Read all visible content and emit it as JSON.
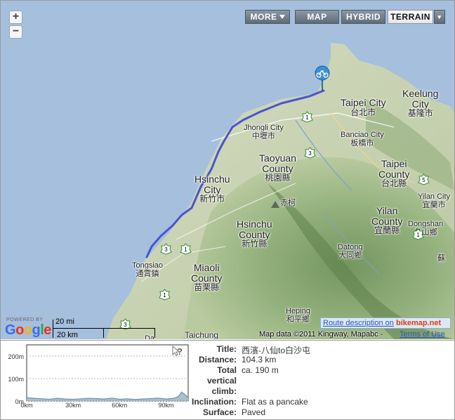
{
  "map_controls": {
    "zoom_in": "+",
    "zoom_out": "−",
    "types": [
      {
        "label": "MORE",
        "has_menu": true
      },
      {
        "label": "MAP"
      },
      {
        "label": "HYBRID"
      },
      {
        "label": "TERRAIN",
        "active": true
      }
    ],
    "dropdown_caret": "▾"
  },
  "places": {
    "taipei_city_en": "Taipei City",
    "taipei_city_zh": "台北市",
    "keelung_en": "Keelung\nCity",
    "keelung_zh": "基隆市",
    "jhongli_en": "Jhongli City",
    "jhongli_zh": "中壢市",
    "banciao_en": "Banciao City",
    "banciao_zh": "板橋市",
    "taoyuan_en": "Taoyuan\nCounty",
    "taoyuan_zh": "桃園縣",
    "taipei_county_en": "Taipei\nCounty",
    "taipei_county_zh": "台北縣",
    "hsinchu_city_en": "Hsinchu\nCity",
    "hsinchu_city_zh": "新竹市",
    "chishan_zh": "赤柯",
    "yilan_city_en": "Yilan City",
    "yilan_city_zh": "宜蘭市",
    "yilan_county_en": "Yilan\nCounty",
    "yilan_county_zh": "宜蘭縣",
    "dongshan_en": "Dongshan",
    "dongshan_zh": "冬山鄉",
    "hsinchu_county_en": "Hsinchu\nCounty",
    "hsinchu_county_zh": "新竹縣",
    "datong_en": "Datong",
    "datong_zh": "大同鄉",
    "su_zh": "蘇",
    "tongsiao_en": "Tongsiao",
    "tongsiao_zh": "通霄鎮",
    "miaoli_en": "Miaoli\nCounty",
    "miaoli_zh": "苗栗縣",
    "heping_en": "Heping",
    "heping_zh": "和平鄉",
    "taichung_en": "Taichung",
    "taichung_partial": "Da"
  },
  "highways": [
    "1",
    "3",
    "5",
    "1",
    "3",
    "1",
    "1",
    "3"
  ],
  "branding": {
    "powered_by": "POWERED BY",
    "google": "Google",
    "google_colors": [
      "#3a6ee8",
      "#e8321d",
      "#f2b40f",
      "#3a6ee8",
      "#2aa748",
      "#e8321d"
    ],
    "route_description": "Route description on",
    "bikemap": "bikemap.net",
    "map_data": "Map data ©2011 Kingway, Mapabc -",
    "terms": "Terms of Use"
  },
  "scale": {
    "miles": "20 mi",
    "km": "20 km"
  },
  "route": {
    "color": "#4a54d0",
    "start_icon": "bicycle-marker"
  },
  "elevation_profile": {
    "type": "area",
    "y_tick_labels": [
      "200m",
      "100m",
      "0m"
    ],
    "x_tick_labels": [
      "0km",
      "30km",
      "60km",
      "90km"
    ],
    "ylim": [
      0,
      250
    ],
    "xlim": [
      0,
      104.3
    ],
    "x": [
      0,
      5,
      10,
      15,
      20,
      25,
      30,
      35,
      40,
      45,
      50,
      55,
      60,
      65,
      70,
      75,
      80,
      85,
      90,
      95,
      98,
      100,
      102,
      104.3
    ],
    "y": [
      15,
      12,
      10,
      8,
      12,
      9,
      8,
      10,
      12,
      11,
      9,
      13,
      8,
      10,
      7,
      9,
      11,
      13,
      9,
      12,
      20,
      40,
      30,
      15
    ],
    "fill": "#9fb3bf",
    "line": "#6a93b2",
    "help_icon": "?"
  },
  "details": [
    {
      "key": "Title:",
      "value": "西濱-八仙to白沙屯"
    },
    {
      "key": "Distance:",
      "value": "104.3 km"
    },
    {
      "key": "Total",
      "value": "ca. 190 m"
    },
    {
      "key": "vertical",
      "value": ""
    },
    {
      "key": "climb:",
      "value": ""
    },
    {
      "key": "Inclination:",
      "value": "Flat as a pancake"
    },
    {
      "key": "Surface:",
      "value": "Paved"
    }
  ]
}
